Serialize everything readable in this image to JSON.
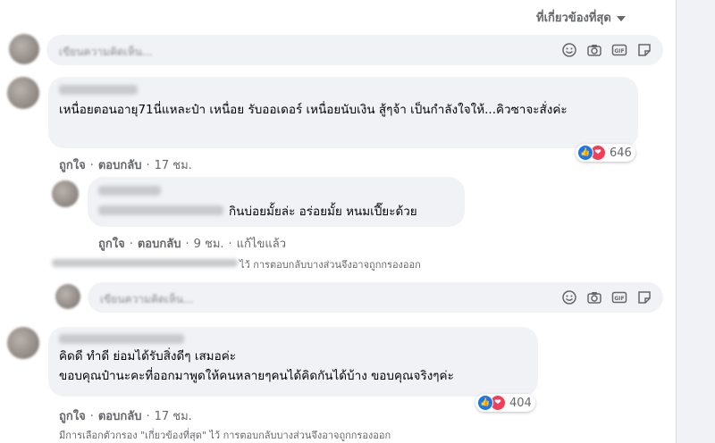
{
  "sort": {
    "label": "ที่เกี่ยวข้องที่สุด"
  },
  "composer": {
    "placeholder": "เขียนความคิดเห็น..."
  },
  "composer_reply": {
    "placeholder": "เขียนความคิดเห็น..."
  },
  "comments": [
    {
      "text": "เหนื่อยตอนอายุ71นี่แหละป๋า เหนื่อย รับออเดอร์ เหนื่อยนับเงิน สู้ๆจ้า เป็นกำลังใจให้...คิวซาจะสั่งค่ะ",
      "like": "ถูกใจ",
      "reply": "ตอบกลับ",
      "time": "17 ชม.",
      "reactions": "646"
    },
    {
      "text": "กินบ่อยมั้ยล่ะ อร่อยมั้ย หนมเปี๊ยะด้วย",
      "like": "ถูกใจ",
      "reply": "ตอบกลับ",
      "time": "9 ชม.",
      "edited": "แก้ไขแล้ว"
    },
    {
      "text_line1": "คิดดี ทำดี ย่อมได้รับสิ่งดีๆ เสมอค่ะ",
      "text_line2": "ขอบคุณป๋านะคะที่ออกมาพูดให้คนหลายๆคนได้คิดกันได้บ้าง ขอบคุณจริงๆค่ะ",
      "like": "ถูกใจ",
      "reply": "ตอบกลับ",
      "time": "17 ชม.",
      "reactions": "404"
    }
  ],
  "filter_note_1": "ไว้ การตอบกลับบางส่วนจึงอาจถูกกรองออก",
  "filter_note_2": "มีการเลือกตัวกรอง \"เกี่ยวข้องที่สุด\" ไว้ การตอบกลับบางส่วนจึงอาจถูกกรองออก",
  "icons": [
    "emoji-icon",
    "camera-icon",
    "gif-icon",
    "sticker-icon"
  ],
  "colors": {
    "like": "#1877f2",
    "love": "#f33e58",
    "bubble": "#f0f2f5",
    "muted": "#65676b"
  }
}
